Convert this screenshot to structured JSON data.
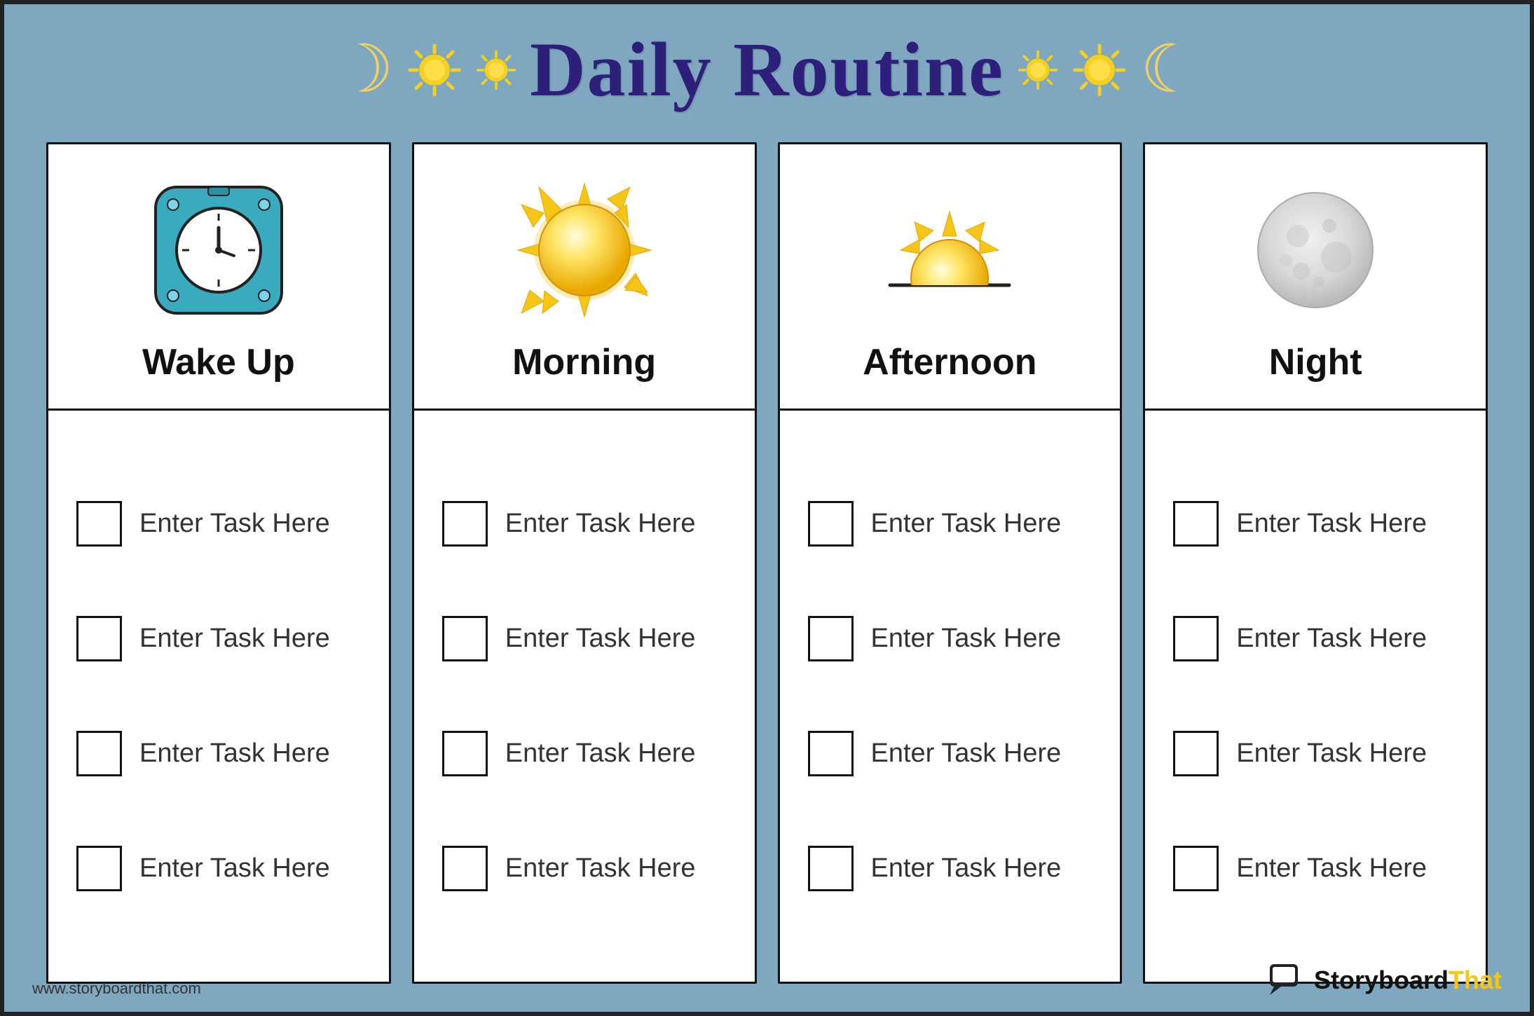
{
  "page": {
    "title": "Daily Routine",
    "background_color": "#7fa8c0",
    "border_color": "#222"
  },
  "header": {
    "title": "Daily Routine",
    "deco_left": [
      "moon",
      "sun",
      "sun"
    ],
    "deco_right": [
      "sun",
      "sun",
      "moon"
    ]
  },
  "columns": [
    {
      "id": "wake-up",
      "title": "Wake Up",
      "icon": "clock",
      "tasks": [
        "Enter Task Here",
        "Enter Task Here",
        "Enter Task Here",
        "Enter Task Here"
      ]
    },
    {
      "id": "morning",
      "title": "Morning",
      "icon": "sun-full",
      "tasks": [
        "Enter Task Here",
        "Enter Task Here",
        "Enter Task Here",
        "Enter Task Here"
      ]
    },
    {
      "id": "afternoon",
      "title": "Afternoon",
      "icon": "sun-horizon",
      "tasks": [
        "Enter Task Here",
        "Enter Task Here",
        "Enter Task Here",
        "Enter Task Here"
      ]
    },
    {
      "id": "night",
      "title": "Night",
      "icon": "moon-full",
      "tasks": [
        "Enter Task Here",
        "Enter Task Here",
        "Enter Task Here",
        "Enter Task Here"
      ]
    }
  ],
  "footer": {
    "url": "www.storyboardthat.com",
    "brand_name": "Storyboard",
    "brand_suffix": "That"
  }
}
